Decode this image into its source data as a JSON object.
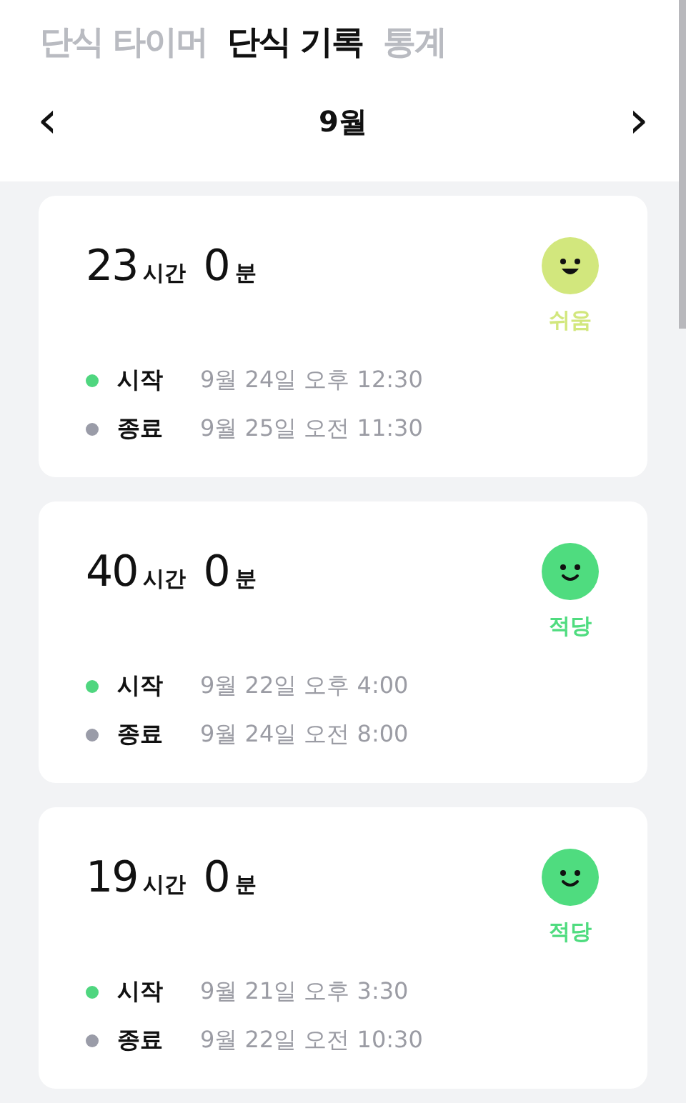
{
  "tabs": [
    {
      "label": "단식 타이머",
      "selected": false
    },
    {
      "label": "단식 기록",
      "selected": true
    },
    {
      "label": "통계",
      "selected": false
    }
  ],
  "month_nav": {
    "prev": "‹",
    "title": "9월",
    "next": "›"
  },
  "records": [
    {
      "hours": "23",
      "hours_unit": "시간",
      "minutes": "0",
      "minutes_unit": "분",
      "mood": {
        "kind": "easy",
        "label": "쉬움",
        "color": "#d2e77d"
      },
      "start": {
        "label": "시작",
        "time": "9월 24일 오후 12:30",
        "color": "#4fd67f"
      },
      "end": {
        "label": "종료",
        "time": "9월 25일 오전 11:30",
        "color": "#9a9ca8"
      }
    },
    {
      "hours": "40",
      "hours_unit": "시간",
      "minutes": "0",
      "minutes_unit": "분",
      "mood": {
        "kind": "moderate",
        "label": "적당",
        "color": "#4fdc7f"
      },
      "start": {
        "label": "시작",
        "time": "9월 22일 오후 4:00",
        "color": "#4fd67f"
      },
      "end": {
        "label": "종료",
        "time": "9월 24일 오전 8:00",
        "color": "#9a9ca8"
      }
    },
    {
      "hours": "19",
      "hours_unit": "시간",
      "minutes": "0",
      "minutes_unit": "분",
      "mood": {
        "kind": "moderate",
        "label": "적당",
        "color": "#4fdc7f"
      },
      "start": {
        "label": "시작",
        "time": "9월 21일 오후 3:30",
        "color": "#4fd67f"
      },
      "end": {
        "label": "종료",
        "time": "9월 22일 오전 10:30",
        "color": "#9a9ca8"
      }
    }
  ]
}
